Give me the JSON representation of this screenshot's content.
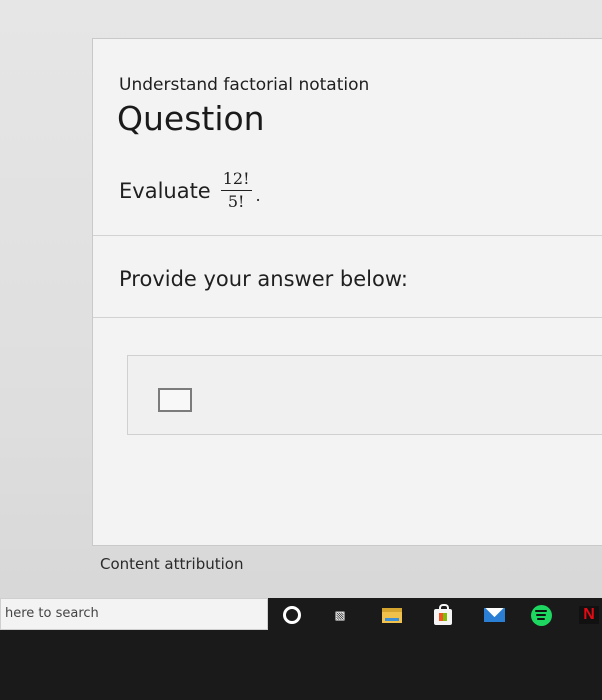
{
  "lesson": {
    "subtitle": "Understand factorial notation",
    "heading": "Question"
  },
  "question": {
    "lead": "Evaluate",
    "numerator": "12!",
    "denominator": "5!",
    "trailing": "."
  },
  "answer": {
    "prompt": "Provide your answer below:",
    "value": ""
  },
  "footer": {
    "attribution": "Content attribution"
  },
  "taskbar": {
    "search_text": "here to search",
    "netflix_label": "N",
    "icons": [
      "cortana-icon",
      "task-view-icon",
      "file-explorer-icon",
      "store-icon",
      "mail-icon",
      "spotify-icon",
      "netflix-icon"
    ]
  },
  "colors": {
    "taskbar_bg": "#1a1a1a",
    "spotify": "#1ed760",
    "netflix": "#e50914",
    "mail": "#2a7fd4",
    "folder": "#f0c24b"
  }
}
